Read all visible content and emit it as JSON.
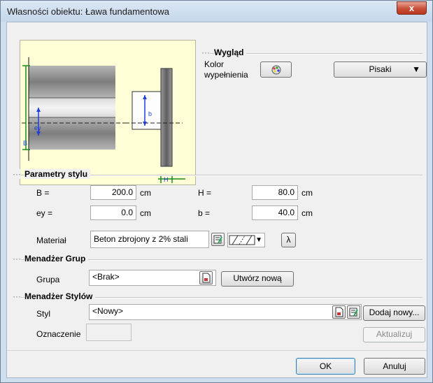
{
  "window": {
    "title": "Własności obiektu: Ława fundamentowa",
    "close_glyph": "x"
  },
  "preview": {
    "label_ey": "ey",
    "label_B": "B",
    "label_b": "b",
    "label_H": "H"
  },
  "appearance": {
    "section_title": "Wygląd",
    "fill_color_label": "Kolor wypełnienia",
    "pens_label": "Pisaki"
  },
  "style_params": {
    "section_title": "Parametry stylu",
    "B_label": "B =",
    "B_value": "200.0",
    "B_unit": "cm",
    "H_label": "H =",
    "H_value": "80.0",
    "H_unit": "cm",
    "ey_label": "ey =",
    "ey_value": "0.0",
    "ey_unit": "cm",
    "b_label": "b =",
    "b_value": "40.0",
    "b_unit": "cm",
    "material_label": "Materiał",
    "material_value": "Beton zbrojony z 2% stali",
    "lambda_label": "λ"
  },
  "group_manager": {
    "section_title": "Menadżer Grup",
    "group_label": "Grupa",
    "group_value": "<Brak>",
    "create_new_label": "Utwórz nową"
  },
  "style_manager": {
    "section_title": "Menadżer Stylów",
    "style_label": "Styl",
    "style_value": "<Nowy>",
    "add_new_label": "Dodaj nowy...",
    "designation_label": "Oznaczenie",
    "designation_value": "",
    "update_label": "Aktualizuj"
  },
  "footer": {
    "ok_label": "OK",
    "cancel_label": "Anuluj"
  },
  "colors": {
    "preview_bg": "#fffed6",
    "dimension_blue": "#1f3fd8",
    "dimension_green": "#1a8c1a",
    "close_red": "#c9503a"
  }
}
